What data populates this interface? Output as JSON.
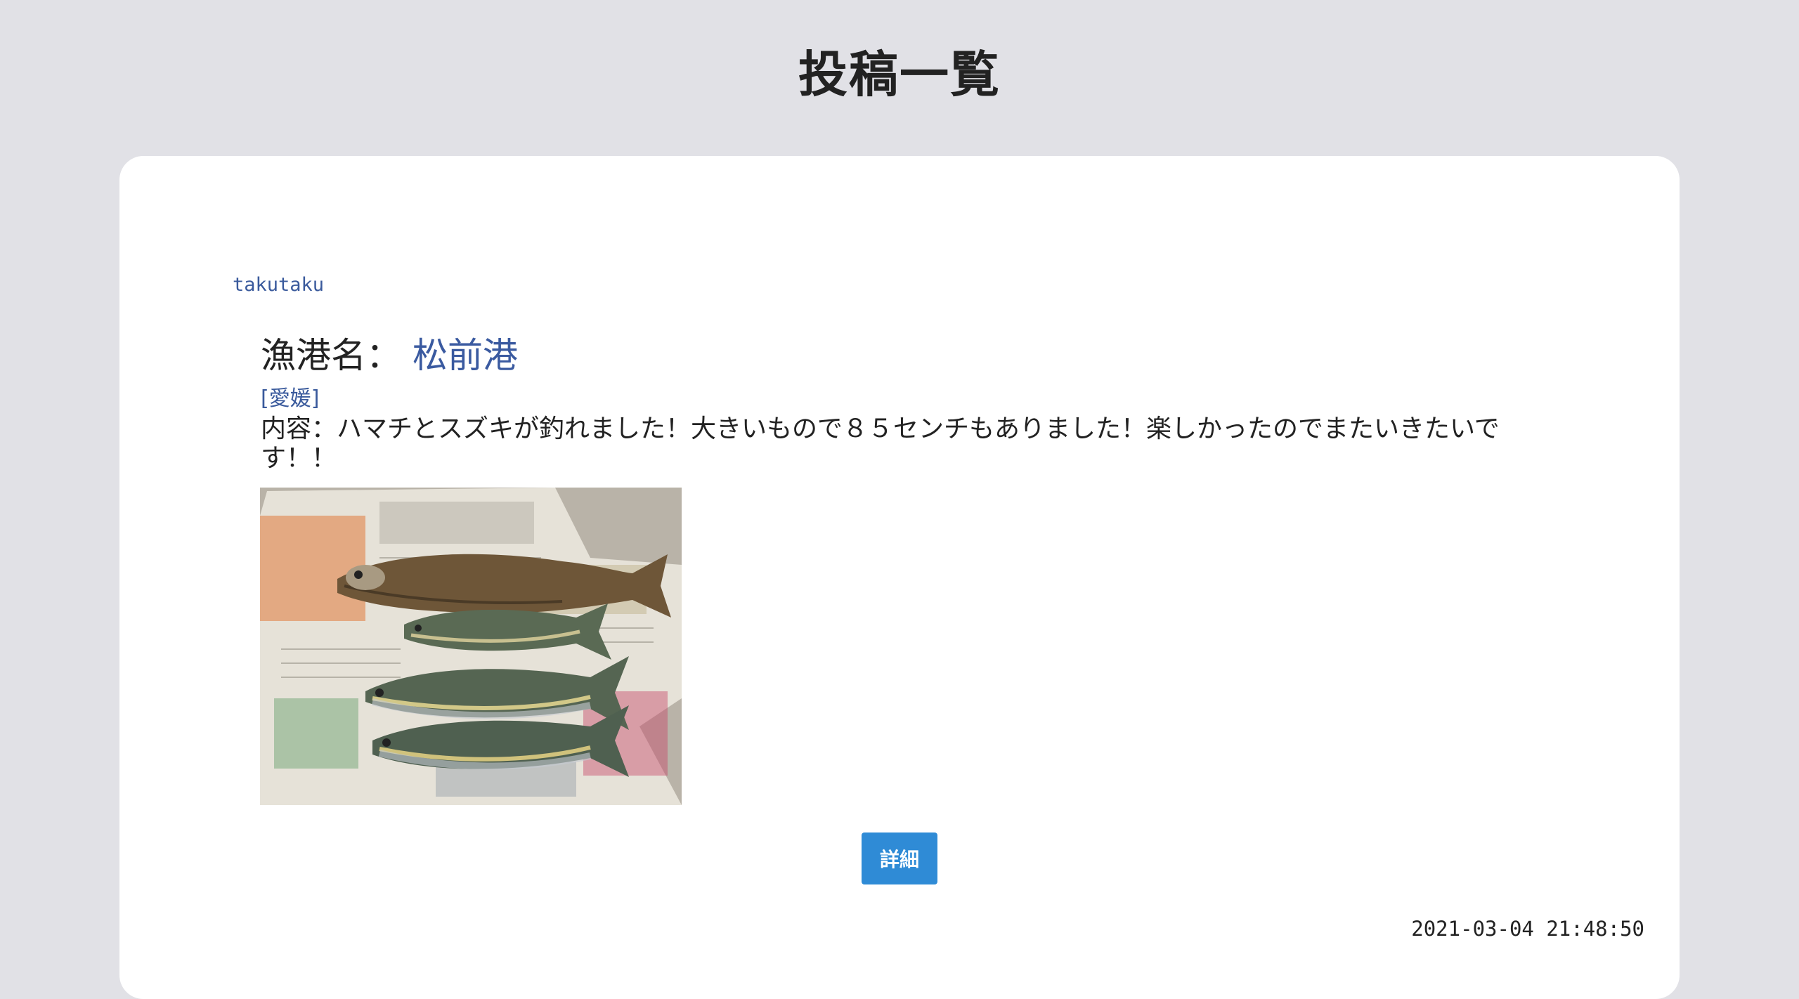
{
  "page": {
    "title": "投稿一覧"
  },
  "post": {
    "author": "takutaku",
    "port_label": "漁港名：",
    "port_name": "松前港",
    "prefecture": "[愛媛]",
    "content": "内容：ハマチとスズキが釣れました！大きいもので８５センチもありました！楽しかったのでまたいきたいです！！",
    "image_alt": "ハマチとスズキの写真",
    "detail_label": "詳細",
    "timestamp": "2021-03-04 21:48:50"
  },
  "colors": {
    "background": "#e1e1e6",
    "card": "#ffffff",
    "link": "#3a5a9c",
    "button": "#2f8bd6"
  },
  "icons": {
    "photo": "fish-photo"
  }
}
